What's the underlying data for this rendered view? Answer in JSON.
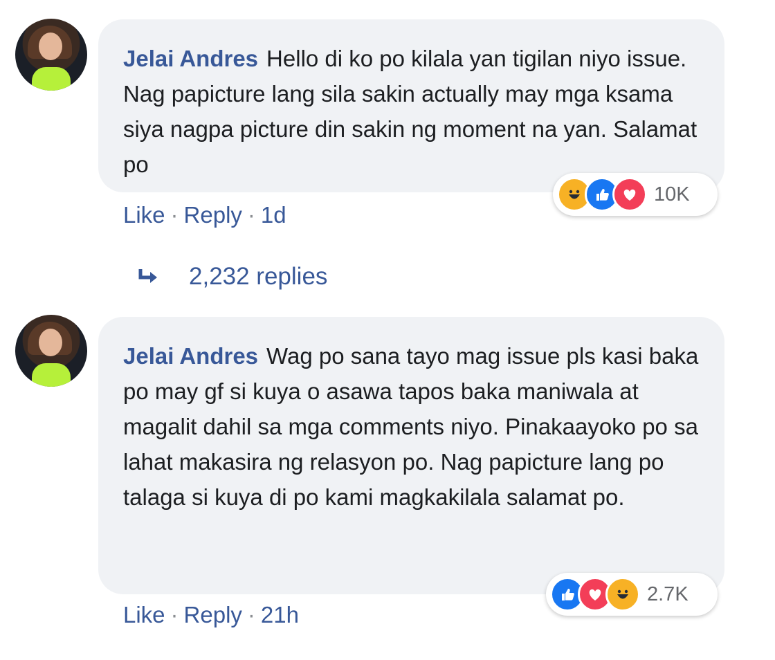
{
  "comments": [
    {
      "author": "Jelai Andres",
      "text": "Hello di ko po kilala yan tigilan niyo issue. Nag papicture lang sila sakin actually may mga ksama siya nagpa picture din sakin ng moment na yan. Salamat po",
      "reactions": [
        "haha",
        "like",
        "love"
      ],
      "reaction_count": "10K",
      "actions": {
        "like": "Like",
        "reply": "Reply",
        "time": "1d"
      }
    },
    {
      "author": "Jelai Andres",
      "text": "Wag po sana tayo mag issue pls kasi baka po may gf si kuya o asawa tapos baka maniwala at magalit dahil sa mga comments niyo. Pinakaayoko po sa lahat makasira ng relasyon po. Nag papicture lang po talaga si kuya di po kami magkakilala salamat po.",
      "reactions": [
        "like",
        "love",
        "haha"
      ],
      "reaction_count": "2.7K",
      "actions": {
        "like": "Like",
        "reply": "Reply",
        "time": "21h"
      }
    }
  ],
  "replies_link": {
    "label": "2,232 replies",
    "icon": "reply-arrow-icon"
  },
  "colors": {
    "link": "#385898",
    "bubble": "#f0f2f5",
    "like": "#1877f2",
    "love": "#f33e58",
    "haha": "#f7b125"
  }
}
